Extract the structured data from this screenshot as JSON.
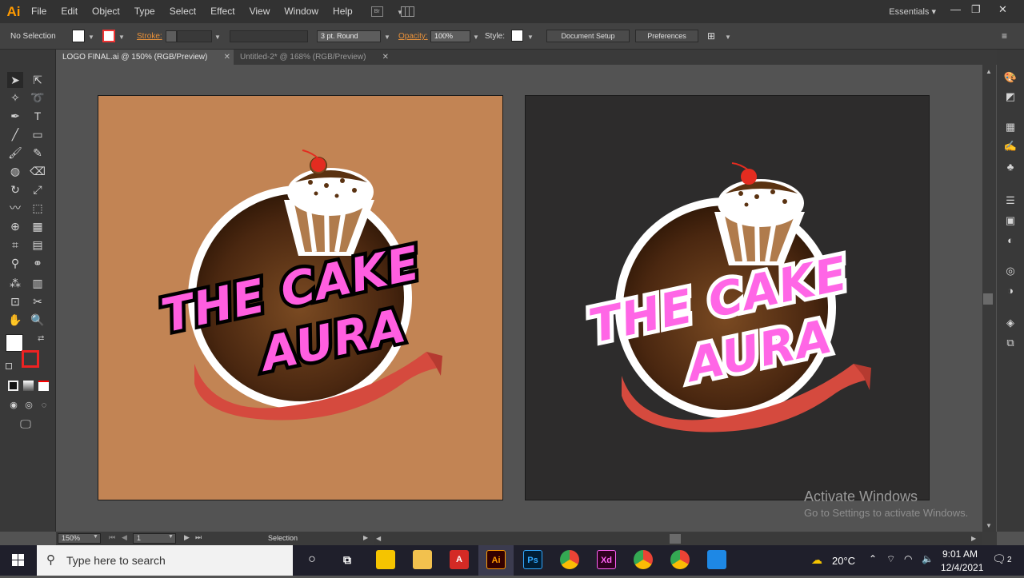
{
  "app": {
    "logo_text": "Ai",
    "menu": [
      "File",
      "Edit",
      "Object",
      "Type",
      "Select",
      "Effect",
      "View",
      "Window",
      "Help"
    ],
    "bridge_icon": "Br",
    "workspace": "Essentials",
    "accent": "#ff9a00"
  },
  "control_bar": {
    "selection_label": "No Selection",
    "stroke_label": "Stroke:",
    "brush_value": "3 pt. Round",
    "opacity_label": "Opacity:",
    "opacity_value": "100%",
    "style_label": "Style:",
    "document_setup_btn": "Document Setup",
    "preferences_btn": "Preferences"
  },
  "tabs": [
    {
      "label": "LOGO FINAL.ai @ 150% (RGB/Preview)",
      "active": true
    },
    {
      "label": "Untitled-2* @ 168% (RGB/Preview)",
      "active": false
    }
  ],
  "status_bar": {
    "zoom": "150%",
    "artboard_num": "1",
    "tool_status": "Selection"
  },
  "artboards": [
    {
      "background": "#c28454",
      "line1": "THE CAKE",
      "line2": "AURA"
    },
    {
      "background": "#2d2c2c",
      "line1": "THE CAKE",
      "line2": "AURA"
    }
  ],
  "watermark": {
    "title": "Activate Windows",
    "subtitle": "Go to Settings to activate Windows."
  },
  "taskbar": {
    "search_placeholder": "Type here to search",
    "apps": [
      "cortana",
      "task-view",
      "sticky-notes",
      "file-explorer",
      "acrobat",
      "illustrator",
      "photoshop",
      "chrome",
      "xd",
      "chrome-2",
      "chrome-3",
      "photos"
    ],
    "ps_label": "Ps",
    "ai_label": "Ai",
    "xd_label": "Xd",
    "weather": "20°C",
    "time": "9:01 AM",
    "date": "12/4/2021",
    "notifications": "2"
  }
}
